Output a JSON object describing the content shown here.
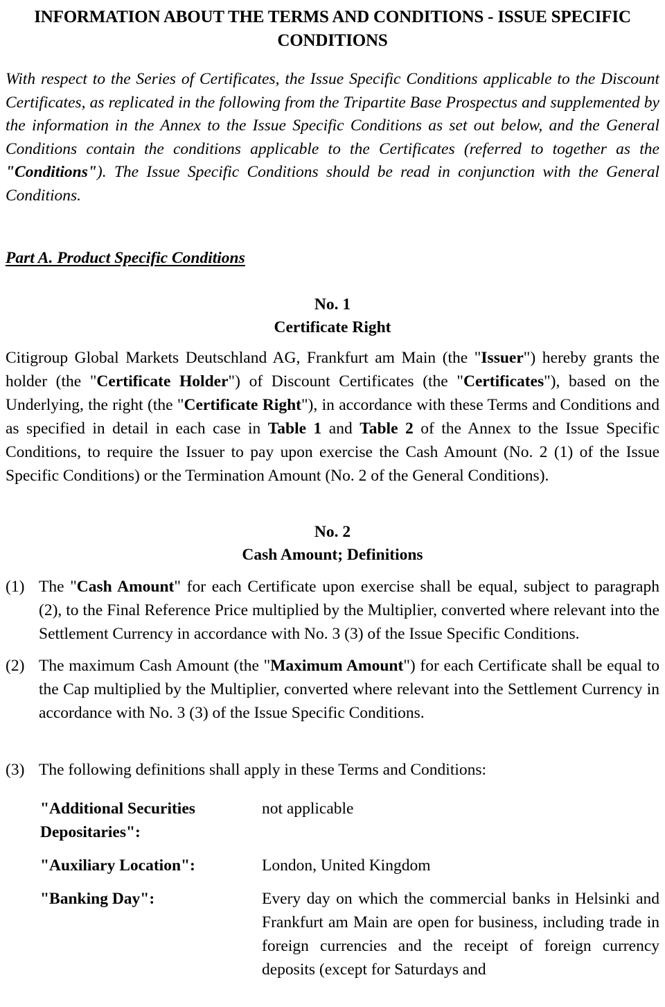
{
  "document": {
    "title": "INFORMATION ABOUT THE TERMS AND CONDITIONS - ISSUE SPECIFIC CONDITIONS",
    "intro": {
      "part1": "With respect to the Series of Certificates, the Issue Specific Conditions applicable to the Discount Certificates, as replicated in the following from the Tripartite Base Prospectus and supplemented by the information in the Annex to the Issue Specific Conditions as set out below, and the General Conditions contain the conditions applicable to the Certificates (referred to together as the ",
      "bold_term": "\"Conditions\"",
      "part2": "). The Issue Specific Conditions should be read in conjunction with the General Conditions."
    },
    "part_heading": "Part A. Product Specific Conditions",
    "sections": [
      {
        "number": "No. 1",
        "subtitle": "Certificate Right",
        "paragraph": {
          "s1": "Citigroup Global Markets Deutschland AG, Frankfurt am Main (the \"",
          "b1": "Issuer",
          "s2": "\") hereby grants the holder (the \"",
          "b2": "Certificate Holder",
          "s3": "\") of Discount Certificates (the \"",
          "b3": "Certificates",
          "s4": "\"), based on the Underlying, the right (the \"",
          "b4": "Certificate Right",
          "s5": "\"), in accordance with these Terms and Conditions and as specified in detail in each case in ",
          "b5": "Table 1",
          "s6": " and ",
          "b6": "Table 2",
          "s7": " of the Annex to the Issue Specific Conditions, to require the Issuer to pay upon exercise the Cash Amount (No. 2 (1) of the Issue Specific Conditions) or the Termination Amount (No. 2 of the General Conditions)."
        }
      },
      {
        "number": "No. 2",
        "subtitle": "Cash Amount; Definitions",
        "items": [
          {
            "marker": "(1)",
            "s1": "The \"",
            "b1": "Cash Amount",
            "s2": "\" for each Certificate upon exercise shall be equal, subject to paragraph (2), to the Final Reference Price multiplied by the Multiplier, converted where relevant into the Settlement Currency in accordance with No. 3 (3) of the Issue Specific Conditions."
          },
          {
            "marker": "(2)",
            "s1": "The maximum Cash Amount (the \"",
            "b1": "Maximum Amount",
            "s2": "\") for each Certificate shall be equal to the Cap multiplied by the Multiplier, converted where relevant into the Settlement Currency in accordance with No. 3 (3) of the Issue Specific Conditions."
          }
        ],
        "definitions_intro": {
          "marker": "(3)",
          "text": "The following definitions shall apply in these Terms and Conditions:"
        },
        "definitions": [
          {
            "term": "\"Additional Securities Depositaries\":",
            "value": "not applicable"
          },
          {
            "term": "\"Auxiliary Location\":",
            "value": "London, United Kingdom"
          },
          {
            "term": "\"Banking Day\":",
            "value": "Every day on which the commercial banks in Helsinki and Frankfurt am Main are open for business, including trade in foreign currencies and the receipt of foreign currency deposits (except for Saturdays and"
          }
        ]
      }
    ]
  }
}
